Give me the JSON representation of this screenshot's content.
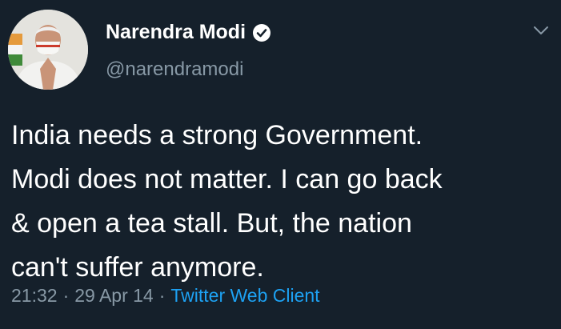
{
  "author": {
    "display_name": "Narendra Modi",
    "handle": "@narendramodi",
    "verified": true,
    "avatar_icon": "profile-photo"
  },
  "tweet": {
    "text": "India needs a strong Government.\nModi does not matter. I can go back\n& open a tea stall. But, the nation\ncan't suffer anymore.",
    "time": "21:32",
    "date": "29 Apr 14",
    "source": "Twitter Web Client",
    "separator": "·"
  },
  "icons": {
    "verified": "verified-badge-icon",
    "menu": "chevron-down-icon"
  },
  "colors": {
    "background": "#15202b",
    "text": "#ffffff",
    "secondary": "#8899a6",
    "link": "#1da1f2"
  }
}
